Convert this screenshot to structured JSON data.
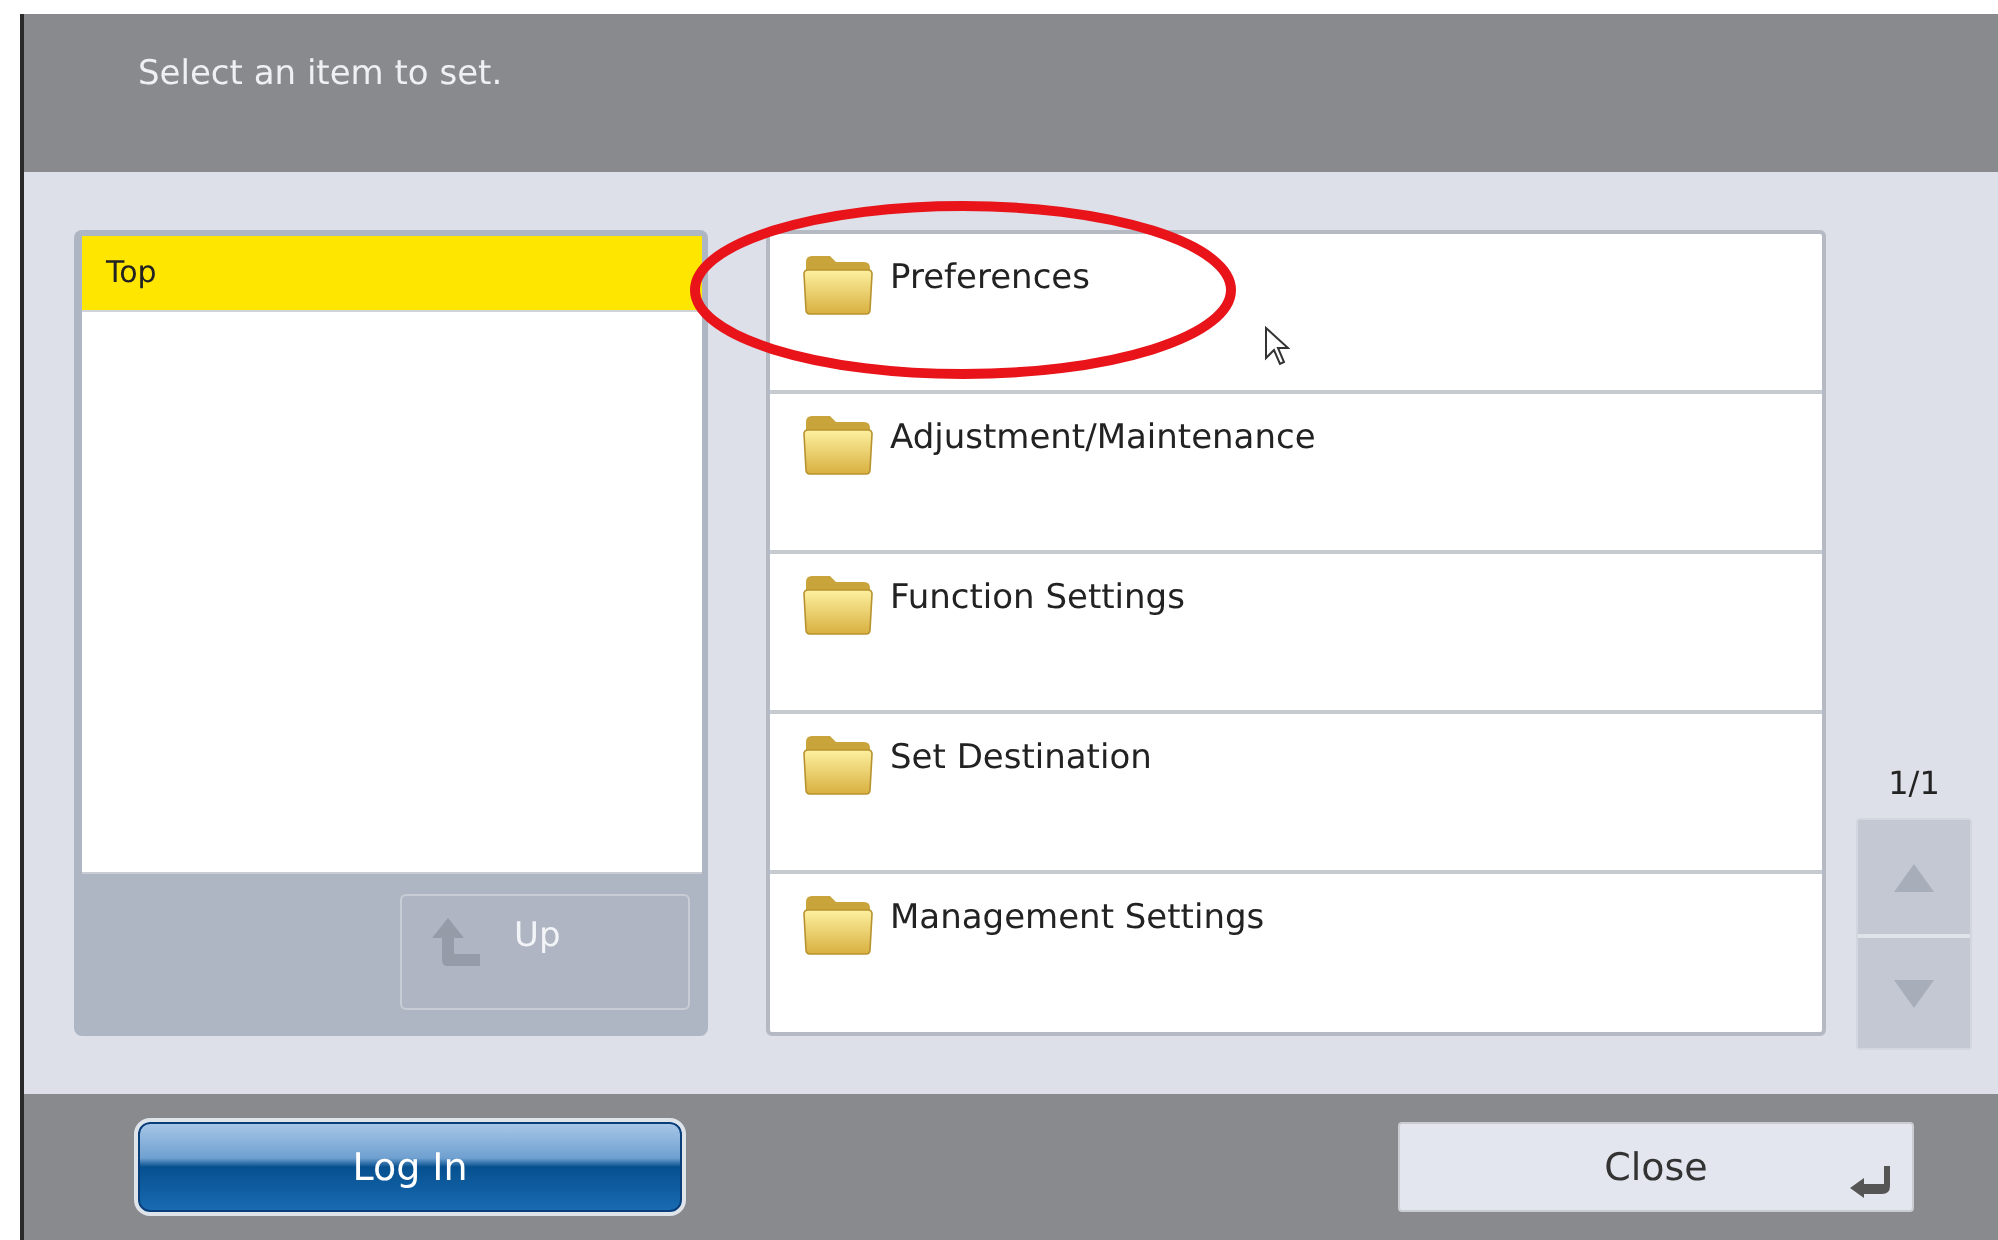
{
  "header": {
    "prompt": "Select an item to set."
  },
  "tree": {
    "items": [
      {
        "label": "Top",
        "selected": true
      }
    ],
    "up_button": {
      "label": "Up",
      "disabled": true
    }
  },
  "items": [
    {
      "label": "Preferences"
    },
    {
      "label": "Adjustment/Maintenance"
    },
    {
      "label": "Function Settings"
    },
    {
      "label": "Set Destination"
    },
    {
      "label": "Management Settings"
    }
  ],
  "pager": {
    "page": "1/1",
    "up_disabled": true,
    "down_disabled": true
  },
  "footer": {
    "login_button": "Log In",
    "close_button": "Close"
  }
}
